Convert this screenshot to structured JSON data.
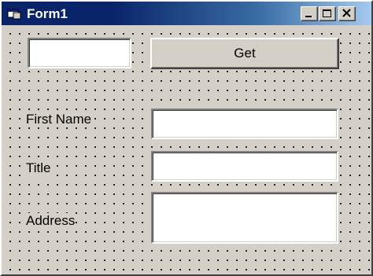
{
  "window": {
    "title": "Form1",
    "titlebar_colors": [
      "#0a246a",
      "#a6caf0"
    ]
  },
  "controls": {
    "search_box_value": "",
    "get_button_label": "Get"
  },
  "fields": {
    "first_name_label": "First Name",
    "first_name_value": "",
    "title_label": "Title",
    "title_value": "",
    "address_label": "Address",
    "address_value": ""
  },
  "icons": [
    "app-icon",
    "minimize-icon",
    "maximize-icon",
    "close-icon"
  ]
}
